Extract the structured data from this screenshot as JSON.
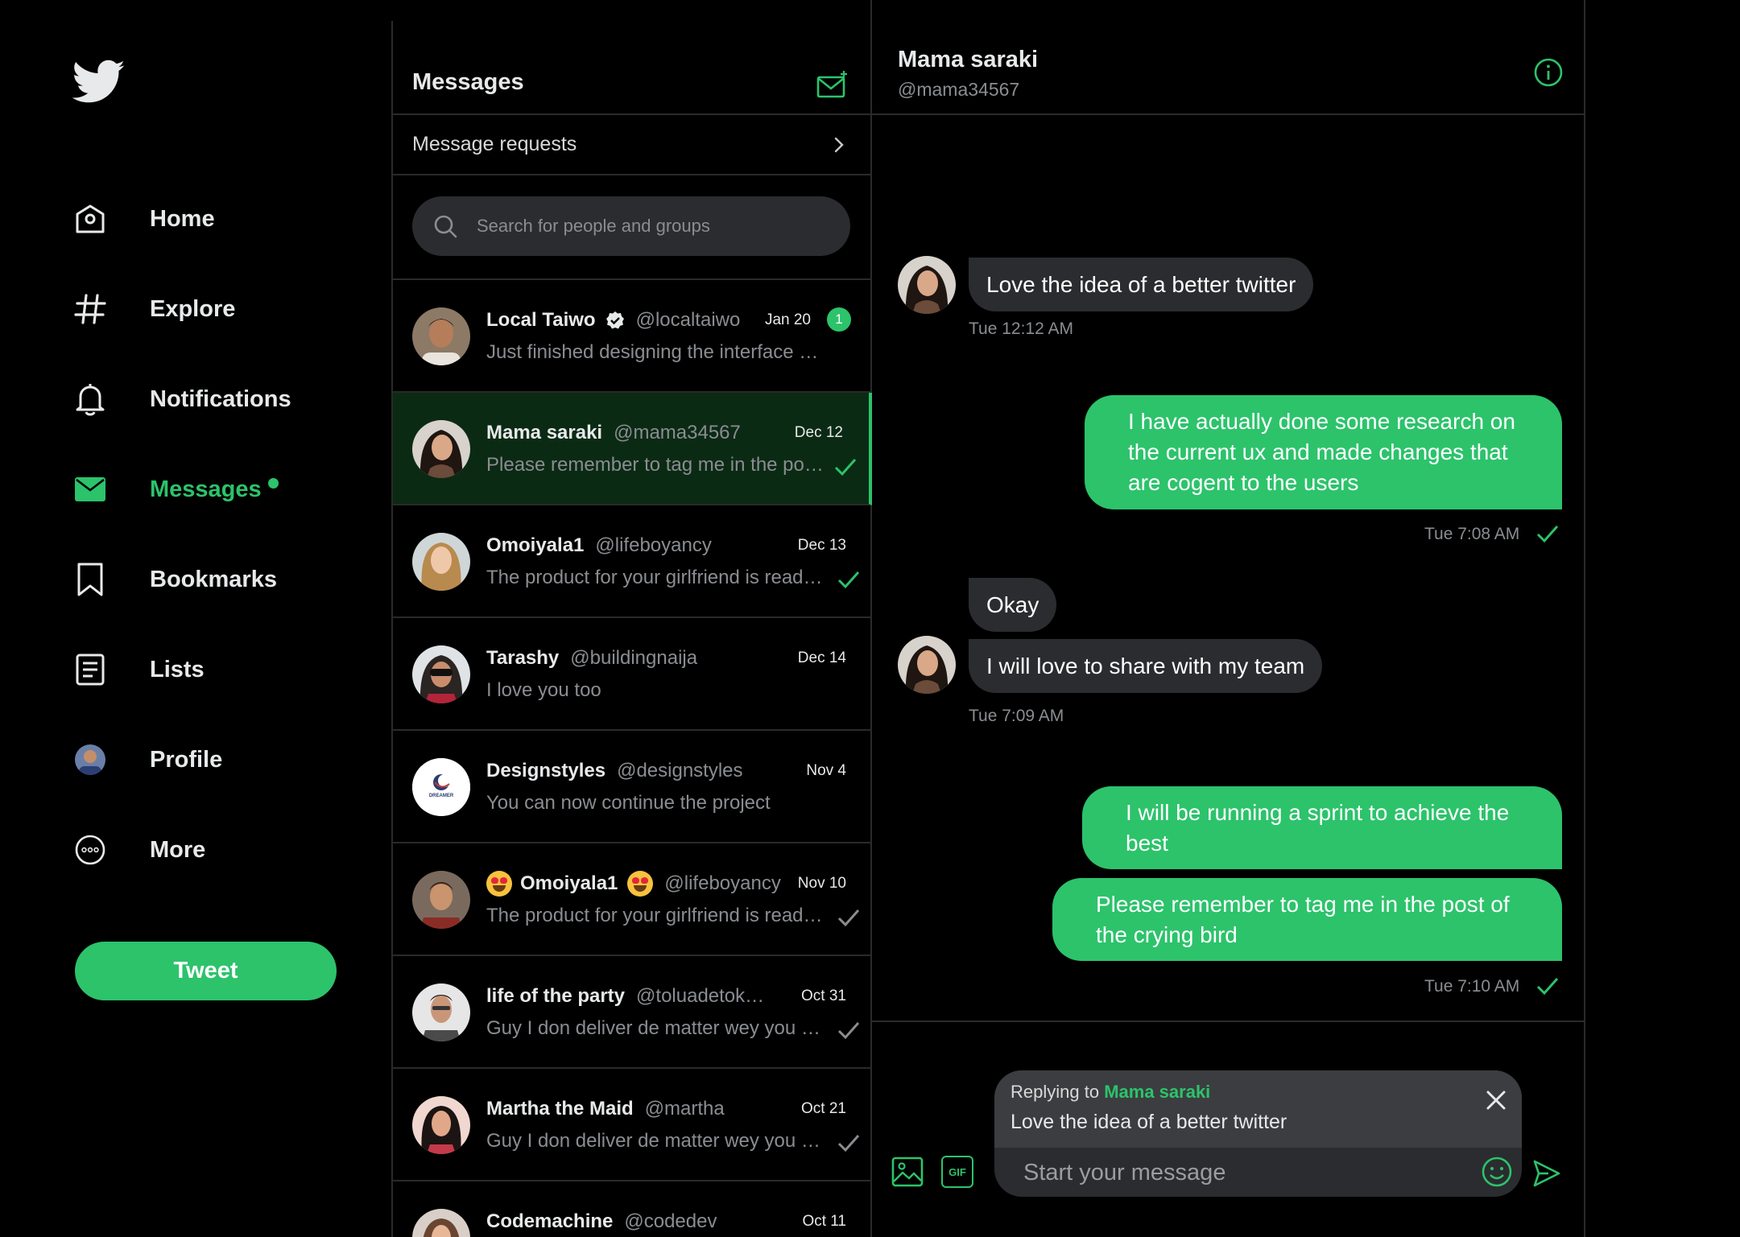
{
  "colors": {
    "accent": "#2cc36b",
    "background": "#000000",
    "bubble_in": "#2b2c2f",
    "bubble_out": "#2cc36b"
  },
  "nav": {
    "logo_icon": "twitter-bird-icon",
    "items": [
      {
        "label": "Home",
        "icon": "home-icon"
      },
      {
        "label": "Explore",
        "icon": "hashtag-icon"
      },
      {
        "label": "Notifications",
        "icon": "bell-icon"
      },
      {
        "label": "Messages",
        "icon": "envelope-icon",
        "active": true
      },
      {
        "label": "Bookmarks",
        "icon": "bookmark-icon"
      },
      {
        "label": "Lists",
        "icon": "list-icon"
      },
      {
        "label": "Profile",
        "icon": "avatar-icon"
      },
      {
        "label": "More",
        "icon": "more-icon"
      }
    ],
    "tweet_label": "Tweet"
  },
  "list": {
    "title": "Messages",
    "compose_icon": "compose-message-icon",
    "requests_label": "Message requests",
    "search_placeholder": "Search for people and groups",
    "conversations": [
      {
        "name": "Local Taiwo",
        "verified": true,
        "handle": "@localtaiwo",
        "date": "Jan 20",
        "preview": "Just finished designing the interface of...",
        "unread": "1"
      },
      {
        "name": "Mama saraki",
        "handle": "@mama34567",
        "date": "Dec 12",
        "preview": "Please remember to tag me in the post of the crying bird",
        "read": true,
        "active": true
      },
      {
        "name": "Omoiyala1",
        "handle": "@lifeboyancy",
        "date": "Dec 13",
        "preview": "The product for your girlfriend is ready for pickup",
        "read": true
      },
      {
        "name": "Tarashy",
        "handle": "@buildingnaija",
        "date": "Dec 14",
        "preview": "I love you too"
      },
      {
        "name": "Designstyles",
        "handle": "@designstyles",
        "date": "Nov 4",
        "preview": "You can now continue the project",
        "avatar_text": "DREAMER"
      },
      {
        "name": "Omoiyala1",
        "handle": "@lifeboyancy",
        "date": "Nov 10",
        "preview": "The product for your girlfriend is ready for pickup",
        "sent": true,
        "emoji": true
      },
      {
        "name": "life of the party",
        "handle": "@toluadetokunbo",
        "date": "Oct 31",
        "preview": "Guy I don deliver de matter wey you order",
        "sent": true
      },
      {
        "name": "Martha the Maid",
        "handle": "@martha",
        "date": "Oct 21",
        "preview": "Guy I don deliver de matter wey you order",
        "sent": true
      },
      {
        "name": "Codemachine",
        "handle": "@codedev",
        "date": "Oct 11",
        "preview": ""
      }
    ]
  },
  "chat": {
    "name": "Mama saraki",
    "handle": "@mama34567",
    "info_icon": "info-icon",
    "messages": [
      {
        "text": "Love the idea of a better twitter"
      },
      {
        "time": "Tue 12:12 AM"
      },
      {
        "text": "I have actually done some research on the current ux and made changes that are cogent to the users"
      },
      {
        "time": "Tue 7:08 AM"
      },
      {
        "text": "Okay"
      },
      {
        "text": "I will love to share with my team"
      },
      {
        "time": "Tue 7:09 AM"
      },
      {
        "text": "I will be running a sprint to achieve the best"
      },
      {
        "text": "Please remember to tag me in the post of the crying bird"
      },
      {
        "time": "Tue 7:10 AM"
      }
    ],
    "reply": {
      "prefix": "Replying to",
      "name": "Mama saraki",
      "text": "Love the idea of a better twitter"
    },
    "input_placeholder": "Start your message",
    "gif_label": "GIF"
  }
}
